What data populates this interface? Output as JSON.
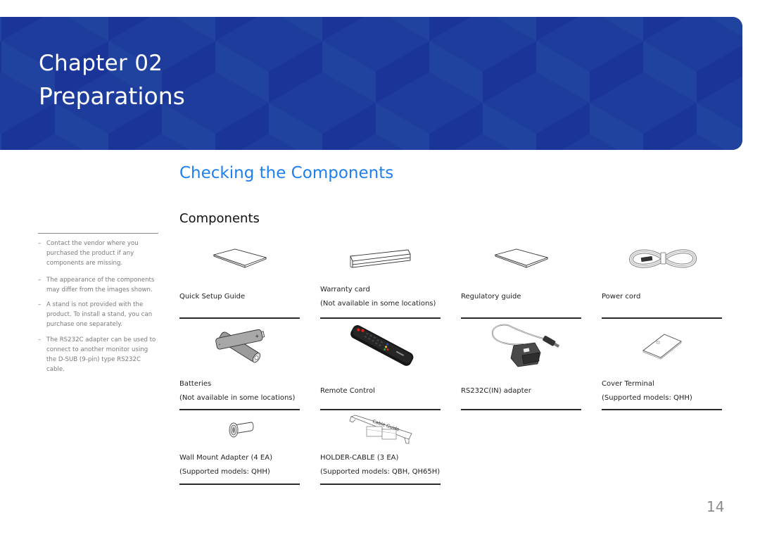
{
  "banner": {
    "chapter_label": "Chapter  02",
    "chapter_title": "Preparations",
    "color": "#1d3a9c"
  },
  "section_title": "Checking the Components",
  "section_title_color": "#1e7ff0",
  "sub_title": "Components",
  "notes": [
    "Contact the vendor where you purchased the product if any components are missing.",
    "The appearance of the components may differ from the images shown.",
    "A stand is not provided with the product. To install a stand, you can purchase one separately.",
    "The RS232C adapter can be used to connect to another monitor using the D-SUB (9-pin) type RS232C cable."
  ],
  "note_dash": "–",
  "components": [
    {
      "name": "Quick Setup Guide",
      "note": "",
      "icon": "booklet-icon"
    },
    {
      "name": "Warranty card",
      "note": "(Not available in some locations)",
      "icon": "warranty-card-icon"
    },
    {
      "name": "Regulatory guide",
      "note": "",
      "icon": "booklet-icon"
    },
    {
      "name": "Power cord",
      "note": "",
      "icon": "power-cord-icon"
    },
    {
      "name": "Batteries",
      "note": "(Not available in some locations)",
      "icon": "batteries-icon"
    },
    {
      "name": "Remote Control",
      "note": "",
      "icon": "remote-control-icon"
    },
    {
      "name": "RS232C(IN) adapter",
      "note": "",
      "icon": "rs232c-adapter-icon"
    },
    {
      "name": "Cover Terminal",
      "note": "(Supported models: QHH)",
      "icon": "cover-terminal-icon"
    },
    {
      "name": "Wall Mount Adapter (4 EA)",
      "note": "(Supported models: QHH)",
      "icon": "wall-mount-adapter-icon"
    },
    {
      "name": "HOLDER-CABLE (3 EA)",
      "note": "(Supported models: QBH, QH65H)",
      "icon": "holder-cable-icon"
    }
  ],
  "holder_cable_print": "Cable Guide",
  "page_number": "14"
}
